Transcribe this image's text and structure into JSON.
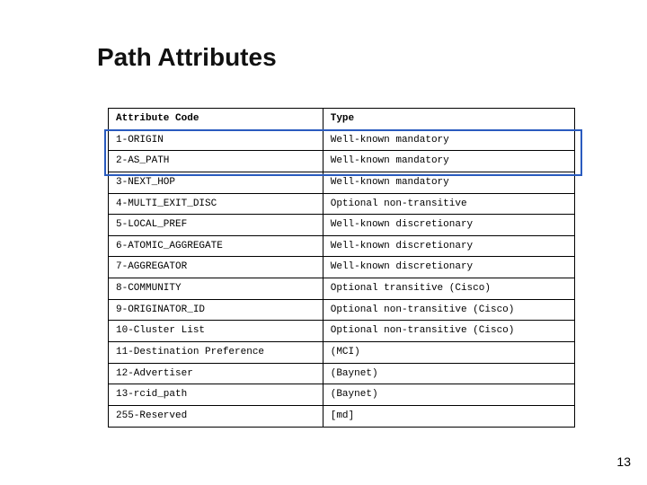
{
  "title": "Path Attributes",
  "table": {
    "headers": {
      "col1": "Attribute Code",
      "col2": "Type"
    },
    "rows": [
      {
        "code": "1-ORIGIN",
        "type": "Well-known mandatory"
      },
      {
        "code": "2-AS_PATH",
        "type": "Well-known mandatory"
      },
      {
        "code": "3-NEXT_HOP",
        "type": "Well-known mandatory"
      },
      {
        "code": "4-MULTI_EXIT_DISC",
        "type": "Optional non-transitive"
      },
      {
        "code": "5-LOCAL_PREF",
        "type": "Well-known discretionary"
      },
      {
        "code": "6-ATOMIC_AGGREGATE",
        "type": "Well-known discretionary"
      },
      {
        "code": "7-AGGREGATOR",
        "type": "Well-known discretionary"
      },
      {
        "code": "8-COMMUNITY",
        "type": "Optional transitive (Cisco)"
      },
      {
        "code": "9-ORIGINATOR_ID",
        "type": "Optional non-transitive (Cisco)"
      },
      {
        "code": "10-Cluster List",
        "type": "Optional non-transitive (Cisco)"
      },
      {
        "code": "11-Destination Preference",
        "type": "(MCI)"
      },
      {
        "code": "12-Advertiser",
        "type": "(Baynet)"
      },
      {
        "code": "13-rcid_path",
        "type": "(Baynet)"
      },
      {
        "code": "255-Reserved",
        "type": "[md]"
      }
    ]
  },
  "page_number": "13"
}
